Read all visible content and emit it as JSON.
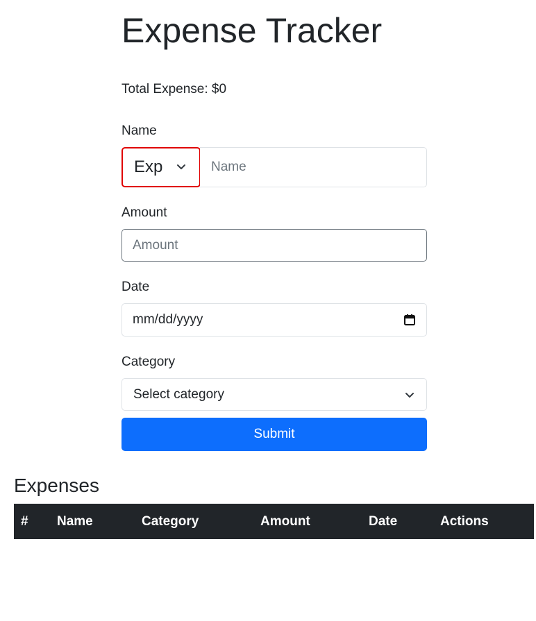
{
  "page": {
    "title": "Expense Tracker",
    "total_label": "Total Expense: $0"
  },
  "form": {
    "name_label": "Name",
    "type_select_value": "Exp",
    "name_placeholder": "Name",
    "amount_label": "Amount",
    "amount_placeholder": "Amount",
    "date_label": "Date",
    "date_placeholder": "mm/dd/yyyy",
    "category_label": "Category",
    "category_value": "Select category",
    "submit_label": "Submit"
  },
  "expenses": {
    "title": "Expenses",
    "columns": [
      "#",
      "Name",
      "Category",
      "Amount",
      "Date",
      "Actions"
    ]
  },
  "colors": {
    "primary": "#0d6efd",
    "header_bg": "#212529",
    "focus_border": "#e00000"
  }
}
